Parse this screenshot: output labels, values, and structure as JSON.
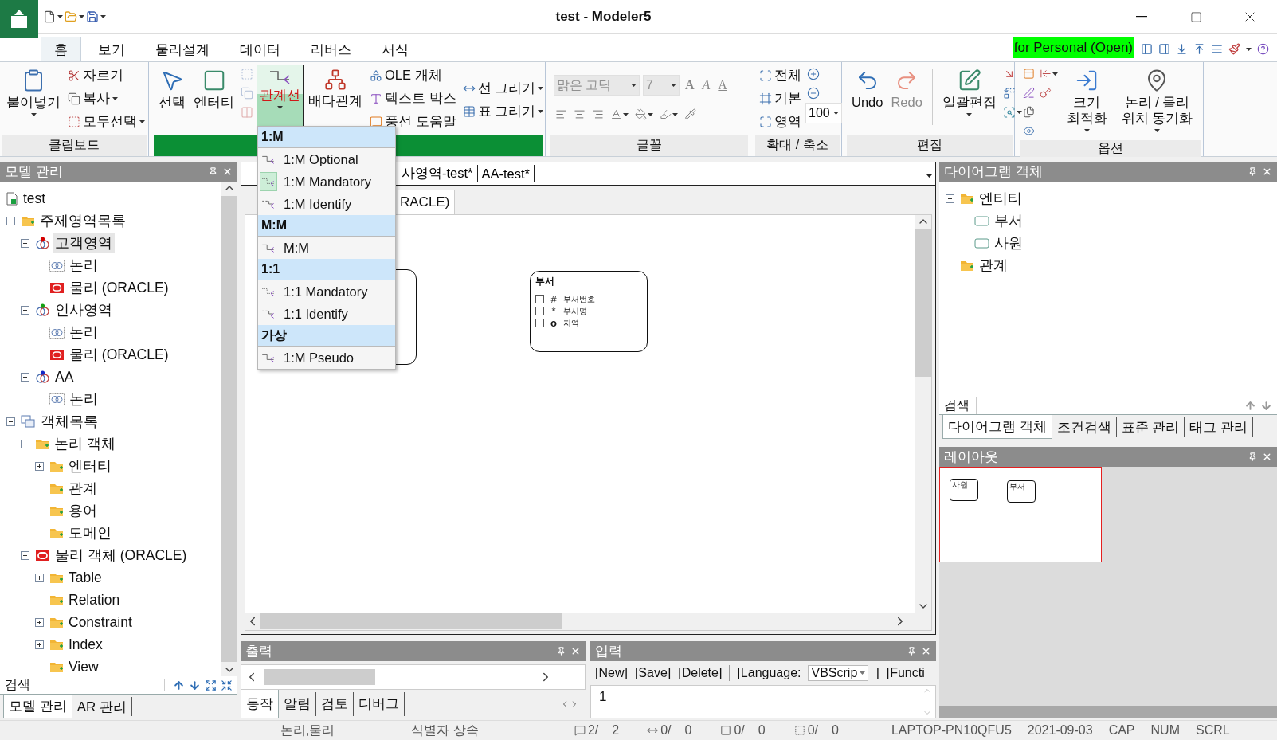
{
  "window": {
    "title": "test - Modeler5"
  },
  "menu_tabs": [
    {
      "label": "홈",
      "selected": true
    },
    {
      "label": "보기",
      "selected": false
    },
    {
      "label": "물리설계",
      "selected": false
    },
    {
      "label": "데이터",
      "selected": false
    },
    {
      "label": "리버스",
      "selected": false
    },
    {
      "label": "서식",
      "selected": false
    }
  ],
  "license": "for Personal (Open)",
  "ribbon": [
    {
      "label": "클립보드",
      "highlighted": false,
      "kind": "columns",
      "parts": [
        [
          {
            "kind": "large",
            "label": "붙여넣기",
            "dropdown": true
          }
        ],
        [
          {
            "kind": "small",
            "label": "자르기"
          },
          {
            "kind": "small",
            "label": "복사",
            "dropdown": true
          },
          {
            "kind": "small",
            "label": "모두선택",
            "dropdown": true
          }
        ]
      ]
    },
    {
      "highlighted": true,
      "kind": "columns",
      "parts": [
        [
          {
            "kind": "large",
            "label": "선택",
            "selected": false
          }
        ],
        [
          {
            "kind": "large",
            "label": "엔터티",
            "selected": false
          }
        ],
        [
          {
            "kind": "icon",
            "disabled": true
          },
          {
            "kind": "icon",
            "disabled": true
          },
          {
            "kind": "icon",
            "disabled": true
          }
        ],
        [
          {
            "kind": "large",
            "label": "관계선",
            "dropdown": true,
            "selected": true
          }
        ],
        [
          {
            "kind": "large",
            "label": "배타관계",
            "selected": false
          }
        ],
        [
          {
            "kind": "small",
            "label": "OLE 개체"
          },
          {
            "kind": "small",
            "label": "텍스트 박스"
          },
          {
            "kind": "small",
            "label": "풍선 도움말"
          }
        ],
        [
          {
            "kind": "small",
            "label": "선 그리기",
            "dropdown": true
          },
          {
            "kind": "small",
            "label": "표 그리기",
            "dropdown": true
          }
        ]
      ]
    },
    {
      "label": "글꼴",
      "highlighted": false,
      "kind": "rows",
      "parts": [
        [
          {
            "kind": "font-field",
            "value": "맑은 고딕",
            "dropdown": true,
            "disabled": true
          },
          {
            "kind": "size-field",
            "value": "7",
            "dropdown": true,
            "disabled": true
          },
          {
            "kind": "text-icon",
            "label": "A"
          },
          {
            "kind": "text-icon",
            "label": "A"
          },
          {
            "kind": "text-icon",
            "label": "A"
          }
        ],
        [
          {
            "kind": "icon"
          },
          {
            "kind": "icon"
          },
          {
            "kind": "icon"
          },
          {
            "kind": "icon",
            "dropdown": true
          },
          {
            "kind": "icon",
            "dropdown": true
          },
          {
            "kind": "icon",
            "dropdown": true
          },
          {
            "kind": "icon"
          }
        ]
      ]
    },
    {
      "label": "확대 / 축소",
      "highlighted": false,
      "kind": "columns",
      "parts": [
        [
          {
            "kind": "small",
            "label": "전체"
          },
          {
            "kind": "small",
            "label": "기본"
          },
          {
            "kind": "small",
            "label": "영역"
          }
        ],
        [
          {
            "kind": "icon"
          },
          {
            "kind": "icon"
          },
          {
            "kind": "size-field",
            "value": "100",
            "dropdown": true
          }
        ]
      ]
    },
    {
      "label": "편집",
      "highlighted": false,
      "kind": "columns",
      "parts": [
        [
          {
            "kind": "large",
            "label": "Undo"
          }
        ],
        [
          {
            "kind": "large",
            "label": "Redo",
            "disabled": true
          }
        ],
        [
          {
            "kind": "separator"
          }
        ],
        [
          {
            "kind": "large",
            "label": "일괄편집",
            "dropdown": true
          }
        ],
        [
          {
            "kind": "icon"
          },
          {
            "kind": "icon"
          },
          {
            "kind": "icon",
            "dropdown": true
          }
        ]
      ]
    },
    {
      "label": "옵션",
      "highlighted": false,
      "kind": "columns",
      "parts": [
        [
          {
            "kind": "icon"
          },
          {
            "kind": "icon"
          },
          {
            "kind": "icon"
          },
          {
            "kind": "icon"
          }
        ],
        [
          {
            "kind": "icon",
            "dropdown": true
          },
          {
            "kind": "icon"
          }
        ],
        [
          {
            "kind": "large",
            "label": "크기 최적화",
            "dropdown": true
          }
        ],
        [
          {
            "kind": "large",
            "label": "논리 / 물리 위치 동기화",
            "dropdown": true
          }
        ]
      ]
    }
  ],
  "relationship_menu": [
    {
      "heading": "1:M",
      "items": [
        {
          "label": "1:M Optional",
          "selected": false
        },
        {
          "label": "1:M Mandatory",
          "selected": true
        },
        {
          "label": "1:M Identify",
          "selected": false
        }
      ]
    },
    {
      "heading": "M:M",
      "items": [
        {
          "label": "M:M",
          "selected": false
        }
      ]
    },
    {
      "heading": "1:1",
      "items": [
        {
          "label": "1:1 Mandatory",
          "selected": false
        },
        {
          "label": "1:1 Identify",
          "selected": false
        }
      ]
    },
    {
      "heading": "가상",
      "items": [
        {
          "label": "1:M Pseudo",
          "selected": false
        }
      ]
    }
  ],
  "model_panel": {
    "title": "모델 관리",
    "nodes": [
      {
        "label": "test",
        "kind": "document",
        "selected": false
      },
      {
        "label": "주제영역목록",
        "kind": "folder",
        "expanded": true,
        "selected": false,
        "children": [
          {
            "label": "고객영역",
            "kind": "subject-area",
            "color": "#d40000",
            "expanded": true,
            "selected": true,
            "children": [
              {
                "label": "논리",
                "kind": "logical",
                "selected": false
              },
              {
                "label": "물리 (ORACLE)",
                "kind": "physical",
                "selected": false
              }
            ]
          },
          {
            "label": "인사영역",
            "kind": "subject-area",
            "color": "#14a014",
            "expanded": true,
            "selected": false,
            "children": [
              {
                "label": "논리",
                "kind": "logical",
                "selected": false
              },
              {
                "label": "물리 (ORACLE)",
                "kind": "physical",
                "selected": false
              }
            ]
          },
          {
            "label": "AA",
            "kind": "subject-area",
            "color": "#1428c8",
            "expanded": true,
            "selected": false,
            "children": [
              {
                "label": "논리",
                "kind": "logical",
                "selected": false
              }
            ]
          }
        ]
      },
      {
        "label": "객체목록",
        "kind": "object-list",
        "expanded": true,
        "selected": false,
        "children": [
          {
            "label": "논리 객체",
            "kind": "folder",
            "expanded": true,
            "selected": false,
            "children": [
              {
                "label": "엔터티",
                "kind": "folder",
                "expanded": false,
                "selected": false
              },
              {
                "label": "관계",
                "kind": "folder",
                "selected": false
              },
              {
                "label": "용어",
                "kind": "folder",
                "selected": false
              },
              {
                "label": "도메인",
                "kind": "folder",
                "selected": false
              }
            ]
          },
          {
            "label": "물리 객체 (ORACLE)",
            "kind": "oracle",
            "expanded": true,
            "selected": false,
            "children": [
              {
                "label": "Table",
                "kind": "folder",
                "expanded": false,
                "selected": false
              },
              {
                "label": "Relation",
                "kind": "folder",
                "selected": false
              },
              {
                "label": "Constraint",
                "kind": "folder",
                "expanded": false,
                "selected": false
              },
              {
                "label": "Index",
                "kind": "folder",
                "expanded": false,
                "selected": false
              },
              {
                "label": "View",
                "kind": "folder",
                "selected": false
              }
            ]
          }
        ]
      }
    ],
    "search_label": "검색",
    "tabs": [
      {
        "label": "모델 관리",
        "selected": true
      },
      {
        "label": "AR 관리",
        "selected": false
      }
    ]
  },
  "doc_tabs": [
    {
      "label": "사영역-test*",
      "selected": false
    },
    {
      "label": "AA-test*",
      "selected": false
    }
  ],
  "sub_tab": "RACLE)",
  "diagram": {
    "entities": [
      {
        "kind": "covered"
      },
      {
        "kind": "entity",
        "name": "부서",
        "attributes": [
          {
            "checked": false,
            "symbol": "#",
            "name": "부서번호"
          },
          {
            "checked": false,
            "symbol": "*",
            "name": "부서명"
          },
          {
            "checked": false,
            "symbol": "o",
            "name": "지역"
          }
        ]
      }
    ]
  },
  "output_panel": {
    "title": "출력",
    "tabs": [
      {
        "label": "동작",
        "selected": true
      },
      {
        "label": "알림",
        "selected": false
      },
      {
        "label": "검토",
        "selected": false
      },
      {
        "label": "디버그",
        "selected": false
      }
    ]
  },
  "input_panel": {
    "title": "입력",
    "toolbar": [
      "[New]",
      "[Save]",
      "[Delete]"
    ],
    "language_label": "[Language:",
    "language": "VBScrip",
    "language_end": "]",
    "function_label": "[Functi",
    "line_number": "1"
  },
  "object_panel": {
    "title": "다이어그램 객체",
    "nodes": [
      {
        "label": "엔터티",
        "kind": "folder",
        "expanded": true,
        "selected": false,
        "children": [
          {
            "label": "부서",
            "kind": "entity",
            "selected": false
          },
          {
            "label": "사원",
            "kind": "entity",
            "selected": false
          }
        ]
      },
      {
        "label": "관계",
        "kind": "folder",
        "selected": false
      }
    ],
    "search_label": "검색",
    "tabs": [
      {
        "label": "다이어그램 객체",
        "selected": true
      },
      {
        "label": "조건검색",
        "selected": false
      },
      {
        "label": "표준 관리",
        "selected": false
      },
      {
        "label": "태그 관리",
        "selected": false
      }
    ]
  },
  "layout_panel": {
    "title": "레이아웃",
    "entities": [
      "사원",
      "부서"
    ]
  },
  "status_bar": {
    "modes": [
      "논리,물리",
      "식별자 상속"
    ],
    "counters": [
      {
        "count": "2/",
        "total": "2"
      },
      {
        "count": "0/",
        "total": "0"
      },
      {
        "count": "0/",
        "total": "0"
      },
      {
        "count": "0/",
        "total": "0"
      }
    ],
    "info": [
      "LAPTOP-PN10QFU5",
      "2021-09-03",
      "CAP",
      "NUM",
      "SCRL"
    ]
  }
}
